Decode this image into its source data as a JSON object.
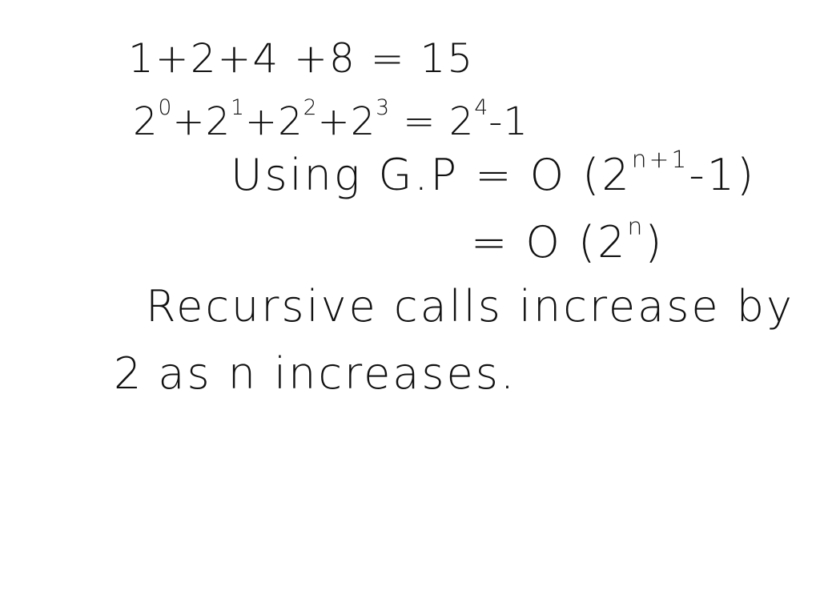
{
  "notes": {
    "line1": "1+2+4 +8 = 15",
    "line2": {
      "t1_base": "2",
      "t1_exp": "0",
      "op1": "+",
      "t2_base": "2",
      "t2_exp": "1",
      "op2": "+",
      "t3_base": "2",
      "t3_exp": "2",
      "op3": "+",
      "t4_base": "2",
      "t4_exp": "3",
      "eq": " = ",
      "r_base": "2",
      "r_exp": "4",
      "r_tail": "-1"
    },
    "line3": {
      "pre": "Using G.P = O (2",
      "exp": "n+1",
      "post": "-1)"
    },
    "line4": {
      "pre": "= O (2",
      "exp": "n",
      "post": ")"
    },
    "line5": "Recursive calls increase by",
    "line6": {
      "a": "2",
      "b": "as n increases."
    }
  },
  "colors": {
    "ink": "#111111",
    "background": "#ffffff"
  }
}
